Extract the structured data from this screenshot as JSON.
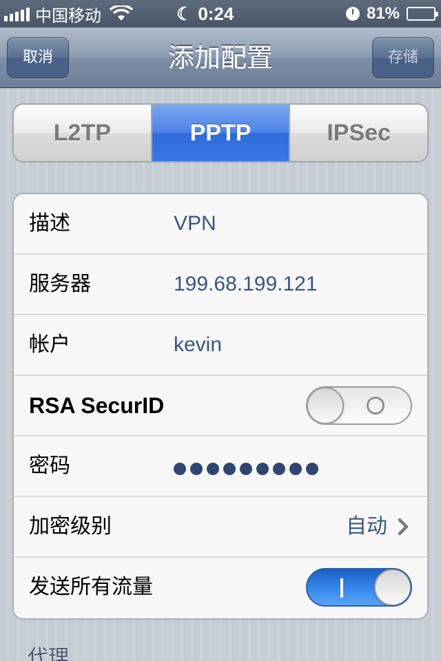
{
  "status_bar": {
    "carrier": "中国移动",
    "time": "0:24",
    "battery": "81%",
    "battery_level": 0.81
  },
  "nav": {
    "title": "添加配置",
    "cancel_label": "取消",
    "save_label": "存储"
  },
  "segments": [
    {
      "label": "L2TP",
      "selected": false
    },
    {
      "label": "PPTP",
      "selected": true
    },
    {
      "label": "IPSec",
      "selected": false
    }
  ],
  "form": {
    "description": {
      "label": "描述",
      "value": "VPN"
    },
    "server": {
      "label": "服务器",
      "value": "199.68.199.121"
    },
    "account": {
      "label": "帐户",
      "value": "kevin"
    },
    "rsa": {
      "label": "RSA SecurID",
      "on": false
    },
    "password": {
      "label": "密码",
      "length": 9
    },
    "encryption": {
      "label": "加密级别",
      "value": "自动"
    },
    "send_all_traffic": {
      "label": "发送所有流量",
      "on": true
    }
  },
  "section": {
    "proxy_header": "代理"
  },
  "colors": {
    "accent_blue": "#3a78e6",
    "value_text": "#385487"
  }
}
